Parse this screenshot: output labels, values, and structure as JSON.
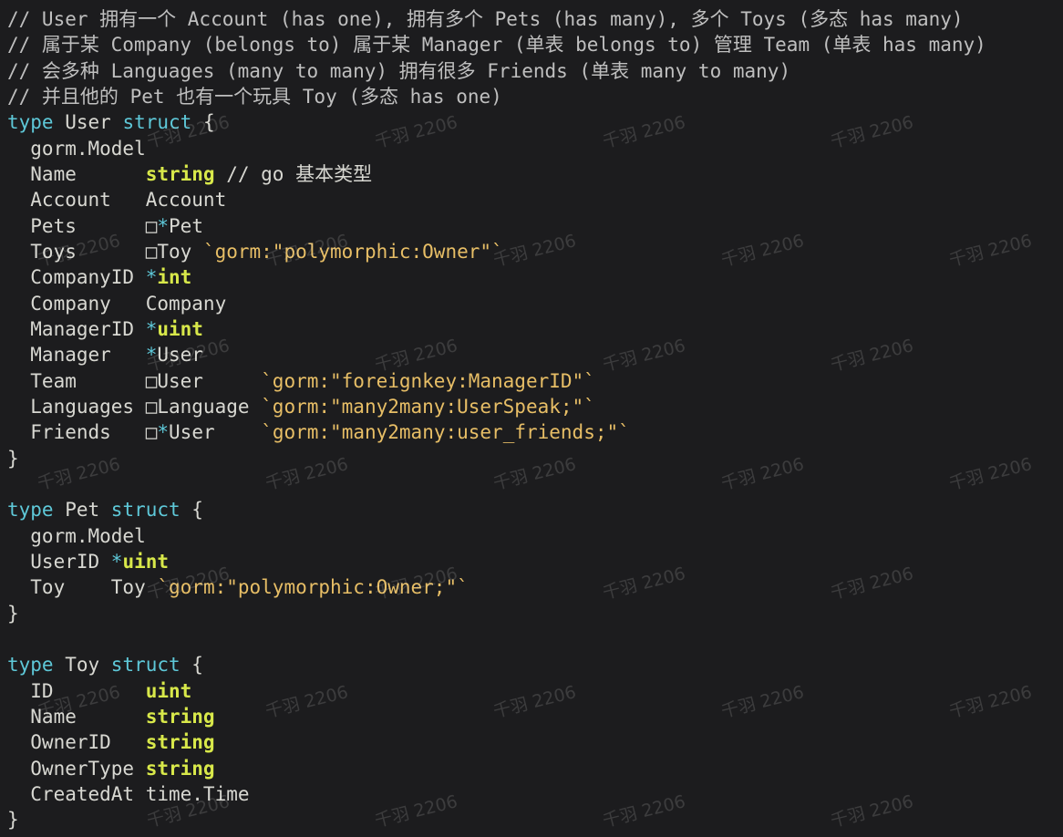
{
  "code_lines": [
    [
      {
        "c": "cm",
        "t": "// User 拥有一个 Account (has one), 拥有多个 Pets (has many), 多个 Toys (多态 has many)"
      }
    ],
    [
      {
        "c": "cm",
        "t": "// 属于某 Company (belongs to) 属于某 Manager (单表 belongs to) 管理 Team (单表 has many)"
      }
    ],
    [
      {
        "c": "cm",
        "t": "// 会多种 Languages (many to many) 拥有很多 Friends (单表 many to many)"
      }
    ],
    [
      {
        "c": "cm",
        "t": "// 并且他的 Pet 也有一个玩具 Toy (多态 has one)"
      }
    ],
    [
      {
        "c": "kw",
        "t": "type"
      },
      {
        "c": "nm",
        "t": " User "
      },
      {
        "c": "kw",
        "t": "struct"
      },
      {
        "c": "nm",
        "t": " {"
      }
    ],
    [
      {
        "c": "nm",
        "t": "  gorm.Model"
      }
    ],
    [
      {
        "c": "nm",
        "t": "  Name      "
      },
      {
        "c": "bt",
        "t": "string"
      },
      {
        "c": "nm",
        "t": " // go 基本类型"
      }
    ],
    [
      {
        "c": "nm",
        "t": "  Account   Account"
      }
    ],
    [
      {
        "c": "nm",
        "t": "  Pets      □"
      },
      {
        "c": "st",
        "t": "*"
      },
      {
        "c": "nm",
        "t": "Pet"
      }
    ],
    [
      {
        "c": "nm",
        "t": "  Toys      □Toy "
      },
      {
        "c": "tg",
        "t": "`gorm:\"polymorphic:Owner\"`"
      }
    ],
    [
      {
        "c": "nm",
        "t": "  CompanyID "
      },
      {
        "c": "st",
        "t": "*"
      },
      {
        "c": "bt",
        "t": "int"
      }
    ],
    [
      {
        "c": "nm",
        "t": "  Company   Company"
      }
    ],
    [
      {
        "c": "nm",
        "t": "  ManagerID "
      },
      {
        "c": "st",
        "t": "*"
      },
      {
        "c": "bt",
        "t": "uint"
      }
    ],
    [
      {
        "c": "nm",
        "t": "  Manager   "
      },
      {
        "c": "st",
        "t": "*"
      },
      {
        "c": "nm",
        "t": "User"
      }
    ],
    [
      {
        "c": "nm",
        "t": "  Team      □User     "
      },
      {
        "c": "tg",
        "t": "`gorm:\"foreignkey:ManagerID\"`"
      }
    ],
    [
      {
        "c": "nm",
        "t": "  Languages □Language "
      },
      {
        "c": "tg",
        "t": "`gorm:\"many2many:UserSpeak;\"`"
      }
    ],
    [
      {
        "c": "nm",
        "t": "  Friends   □"
      },
      {
        "c": "st",
        "t": "*"
      },
      {
        "c": "nm",
        "t": "User    "
      },
      {
        "c": "tg",
        "t": "`gorm:\"many2many:user_friends;\"`"
      }
    ],
    [
      {
        "c": "nm",
        "t": "}"
      }
    ],
    [
      {
        "c": "nm",
        "t": ""
      }
    ],
    [
      {
        "c": "kw",
        "t": "type"
      },
      {
        "c": "nm",
        "t": " Pet "
      },
      {
        "c": "kw",
        "t": "struct"
      },
      {
        "c": "nm",
        "t": " {"
      }
    ],
    [
      {
        "c": "nm",
        "t": "  gorm.Model"
      }
    ],
    [
      {
        "c": "nm",
        "t": "  UserID "
      },
      {
        "c": "st",
        "t": "*"
      },
      {
        "c": "bt",
        "t": "uint"
      }
    ],
    [
      {
        "c": "nm",
        "t": "  Toy    Toy "
      },
      {
        "c": "tg",
        "t": "`gorm:\"polymorphic:Owner;\"`"
      }
    ],
    [
      {
        "c": "nm",
        "t": "}"
      }
    ],
    [
      {
        "c": "nm",
        "t": ""
      }
    ],
    [
      {
        "c": "kw",
        "t": "type"
      },
      {
        "c": "nm",
        "t": " Toy "
      },
      {
        "c": "kw",
        "t": "struct"
      },
      {
        "c": "nm",
        "t": " {"
      }
    ],
    [
      {
        "c": "nm",
        "t": "  ID        "
      },
      {
        "c": "bt",
        "t": "uint"
      }
    ],
    [
      {
        "c": "nm",
        "t": "  Name      "
      },
      {
        "c": "bt",
        "t": "string"
      }
    ],
    [
      {
        "c": "nm",
        "t": "  OwnerID   "
      },
      {
        "c": "bt",
        "t": "string"
      }
    ],
    [
      {
        "c": "nm",
        "t": "  OwnerType "
      },
      {
        "c": "bt",
        "t": "string"
      }
    ],
    [
      {
        "c": "nm",
        "t": "  CreatedAt time.Time"
      }
    ],
    [
      {
        "c": "nm",
        "t": "}"
      }
    ]
  ],
  "watermark": {
    "text": "千羽 2206"
  },
  "colors": {
    "background": "#1c1c1e",
    "keyword": "#5ec8d8",
    "builtin_type": "#d8e84a",
    "struct_tag": "#e7be66",
    "comment": "#bfbfbf",
    "text": "#d8d8d2"
  }
}
